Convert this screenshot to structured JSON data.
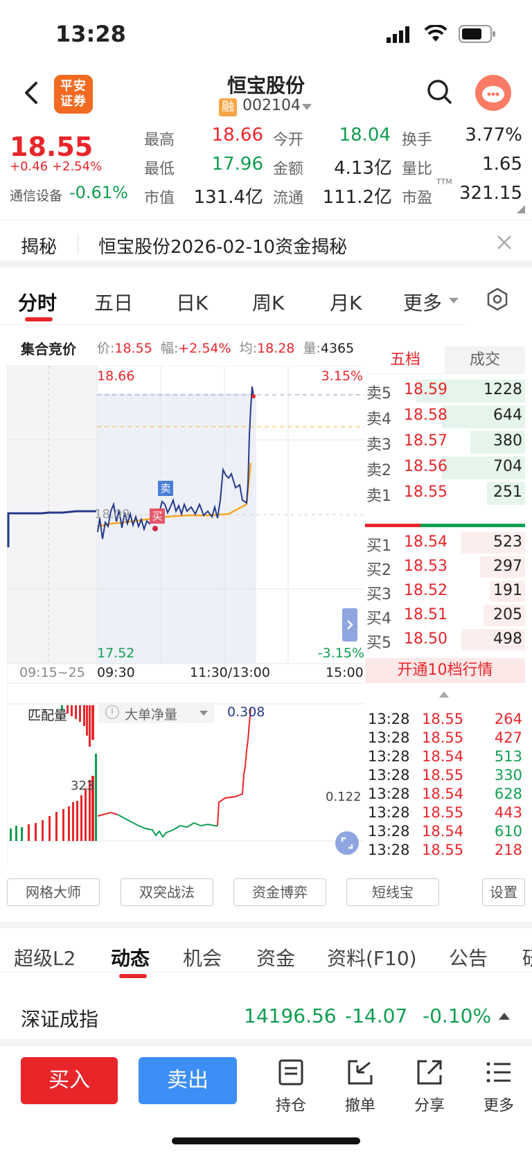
{
  "status_bar": {
    "time": "13:28"
  },
  "header": {
    "broker_logo": "平安证券",
    "stock_name": "恒宝股份",
    "margin_badge": "融",
    "stock_code": "002104"
  },
  "quote": {
    "price": "18.55",
    "change": "+0.46",
    "change_pct": "+2.54%",
    "sector": "通信设备",
    "sector_pct": "-0.61%",
    "high_label": "最高",
    "high": "18.66",
    "low_label": "最低",
    "low": "17.96",
    "mcap_label": "市值",
    "mcap": "131.4亿",
    "open_label": "今开",
    "open": "18.04",
    "amount_label": "金额",
    "amount": "4.13亿",
    "float_label": "流通",
    "float": "111.2亿",
    "turnover_label": "换手",
    "turnover": "3.77%",
    "vol_ratio_label": "量比",
    "vol_ratio": "1.65",
    "pe_label": "市盈",
    "pe_sup": "TTM",
    "pe": "321.15"
  },
  "reveal": {
    "tag": "揭秘",
    "text": "恒宝股份2026-02-10资金揭秘"
  },
  "chart_tabs": [
    "分时",
    "五日",
    "日K",
    "周K",
    "月K",
    "更多"
  ],
  "auction_bar": {
    "label": "集合竞价",
    "price_label": "价:",
    "price": "18.55",
    "pct_label": "幅:",
    "pct": "+2.54%",
    "avg_label": "均:",
    "avg": "18.28",
    "vol_label": "量:",
    "vol": "4365"
  },
  "intraday": {
    "top_price": "18.66",
    "top_pct": "3.15%",
    "bottom_price": "17.52",
    "bottom_pct": "-3.15%",
    "mid_price": "18.09",
    "sell_marker": "卖",
    "buy_marker": "买",
    "time_auction": "09:15~25",
    "time_open": "09:30",
    "time_mid": "11:30/13:00",
    "time_close": "15:00"
  },
  "sub_chart": {
    "match_label": "匹配量",
    "indicator": "大单净量",
    "indicator_value": "0.308",
    "bar_value": "323",
    "right_value": "0.122"
  },
  "order_book": {
    "tab_five": "五档",
    "tab_trades": "成交",
    "asks": [
      {
        "label": "卖5",
        "price": "18.59",
        "vol": "1228"
      },
      {
        "label": "卖4",
        "price": "18.58",
        "vol": "644"
      },
      {
        "label": "卖3",
        "price": "18.57",
        "vol": "380"
      },
      {
        "label": "卖2",
        "price": "18.56",
        "vol": "704"
      },
      {
        "label": "卖1",
        "price": "18.55",
        "vol": "251"
      }
    ],
    "bids": [
      {
        "label": "买1",
        "price": "18.54",
        "vol": "523"
      },
      {
        "label": "买2",
        "price": "18.53",
        "vol": "297"
      },
      {
        "label": "买3",
        "price": "18.52",
        "vol": "191"
      },
      {
        "label": "买4",
        "price": "18.51",
        "vol": "205"
      },
      {
        "label": "买5",
        "price": "18.50",
        "vol": "498"
      }
    ],
    "upgrade_text": "开通10档行情"
  },
  "ticks": [
    {
      "time": "13:28",
      "price": "18.55",
      "vol": "264"
    },
    {
      "time": "13:28",
      "price": "18.55",
      "vol": "427"
    },
    {
      "time": "13:28",
      "price": "18.54",
      "vol": "513"
    },
    {
      "time": "13:28",
      "price": "18.55",
      "vol": "330"
    },
    {
      "time": "13:28",
      "price": "18.54",
      "vol": "628"
    },
    {
      "time": "13:28",
      "price": "18.55",
      "vol": "443"
    },
    {
      "time": "13:28",
      "price": "18.54",
      "vol": "610"
    },
    {
      "time": "13:28",
      "price": "18.55",
      "vol": "218"
    }
  ],
  "tools": [
    "网格大师",
    "双突战法",
    "资金博弈",
    "短线宝",
    "设置"
  ],
  "sub_tabs": [
    "超级L2",
    "动态",
    "机会",
    "资金",
    "资料(F10)",
    "公告",
    "研"
  ],
  "index": {
    "name": "深证成指",
    "value": "14196.56",
    "change": "-14.07",
    "pct": "-0.10%"
  },
  "bottom": {
    "buy": "买入",
    "sell": "卖出",
    "hold": "持仓",
    "cancel": "撤单",
    "share": "分享",
    "more": "更多"
  },
  "colors": {
    "up": "#e8262a",
    "down": "#0f9e4f",
    "buy_button": "#e8262a",
    "sell_button": "#3d8ef5",
    "brand": "#f26a21"
  }
}
